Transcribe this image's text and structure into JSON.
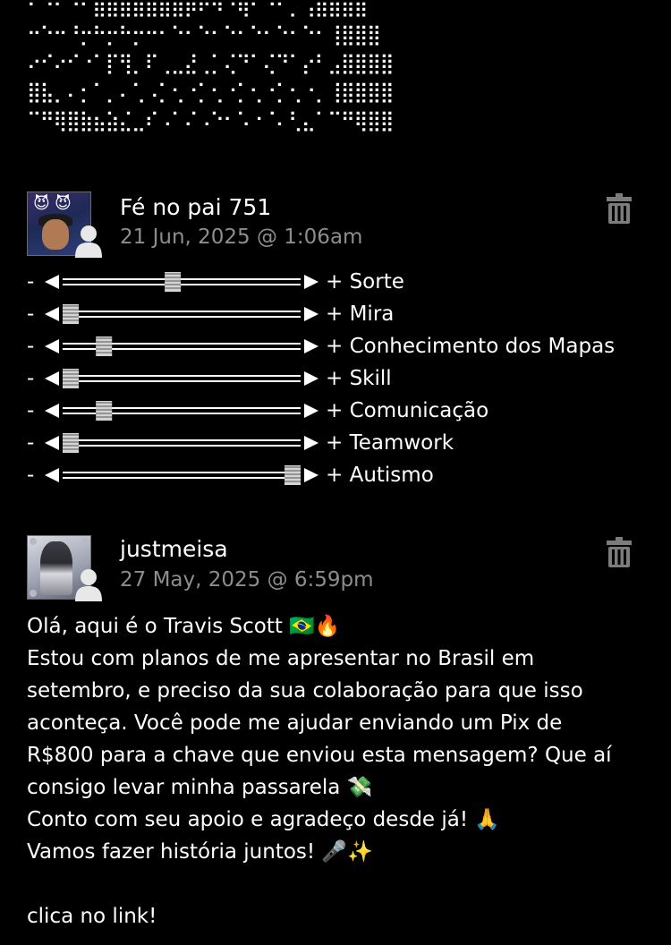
{
  "ascii_art": "⠂⠐⠂⠐⠂⣿⣿⣿⣿⣿⣿⣿⡿⠟⠻⠙⢿⠂⠐⠂⡀⢠⣿⣿⣿⣿\n⠒⠑⠒⠘⡒⠓⡒⠓⡒⠒⠂⠑⠂⠑⠂⠑⠂⠑⠂⠑⠂⠑⠂⢸⣿⣿⣿\n⠔⠊⠔⠊⠐⠁⡏⢻⡀⠏⢀⣀⣜⢀⡁⢌⠙⠁⢌⠙⠁⡔⠃⣠⣿⣿⣿⣿\n⣿⣧⡀⠄⡂⠁⡀⠄⢁⠠⡁⢂⠐⡁⢂⠐⡁⢂⠐⡁⢂⠐⡀⢸⣿⣿⣿⣿\n⠉⠛⢿⣿⣷⣦⣵⣌⣀⠎⠠⠁⠌⠠⠑⠂⠡⠐⠈⠄⢃⣄⠁⠉⠛⢿⣿⣿",
  "comments": [
    {
      "username": "Fé no pai 751",
      "timestamp": "21 Jun, 2025 @ 1:06am",
      "avatar_icon": "devil-emoji-avatar",
      "stats": [
        {
          "minus": "-",
          "label": "+ Sorte",
          "level": 0.46
        },
        {
          "minus": "-",
          "label": "+ Mira",
          "level": 0.0
        },
        {
          "minus": "-",
          "label": "+ Conhecimento dos Mapas",
          "level": 0.15
        },
        {
          "minus": "-",
          "label": "+ Skill",
          "level": 0.0
        },
        {
          "minus": "-",
          "label": "+ Comunicação",
          "level": 0.15
        },
        {
          "minus": "-",
          "label": "+ Teamwork",
          "level": 0.0
        },
        {
          "minus": "-",
          "label": "+ Autismo",
          "level": 1.0
        }
      ]
    },
    {
      "username": "justmeisa",
      "timestamp": "27 May, 2025 @ 6:59pm",
      "avatar_icon": "sad-girl-avatar",
      "message_lines": [
        "Olá, aqui é o Travis Scott 🇧🇷🔥",
        "Estou com planos de me apresentar no Brasil em",
        "setembro, e preciso da sua colaboração para que isso",
        "aconteça. Você pode me ajudar enviando um Pix de",
        "R$800 para a chave que enviou esta mensagem? Que aí",
        "consigo levar minha passarela 💸",
        "Conto com seu apoio e agradeço desde já! 🙏",
        "Vamos fazer história juntos! 🎤✨",
        "",
        "clica no link!"
      ]
    }
  ],
  "icons": {
    "delete": "trash-icon",
    "default_user": "default-user-icon"
  },
  "colors": {
    "background": "#000000",
    "text": "#ffffff",
    "timestamp": "#8d8d8d",
    "icon": "#7c7c7c"
  }
}
